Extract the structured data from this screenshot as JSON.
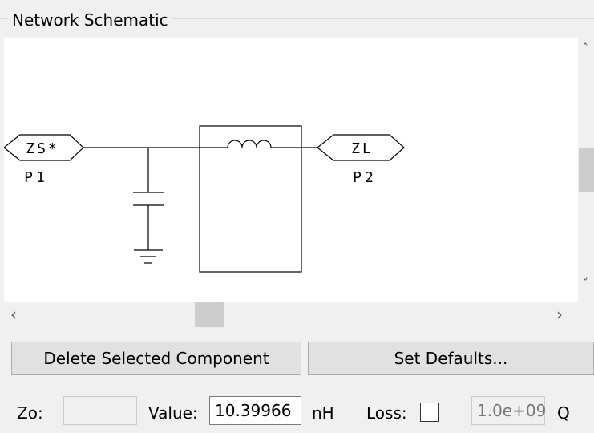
{
  "group": {
    "title": "Network Schematic"
  },
  "schematic": {
    "port1": {
      "symbol": "ZS*",
      "label": "P1"
    },
    "port2": {
      "symbol": "ZL",
      "label": "P2"
    }
  },
  "buttons": {
    "delete_label": "Delete Selected Component",
    "defaults_label": "Set Defaults..."
  },
  "params": {
    "zo_label": "Zo:",
    "zo_value": "",
    "value_label": "Value:",
    "value": "10.39966",
    "unit": "nH",
    "loss_label": "Loss:",
    "loss_checked": false,
    "q_value": "1.0e+09",
    "q_label": "Q"
  },
  "icons": {
    "scroll_up": "chevron-up-icon",
    "scroll_down": "chevron-down-icon",
    "scroll_left": "chevron-left-icon",
    "scroll_right": "chevron-right-icon"
  }
}
